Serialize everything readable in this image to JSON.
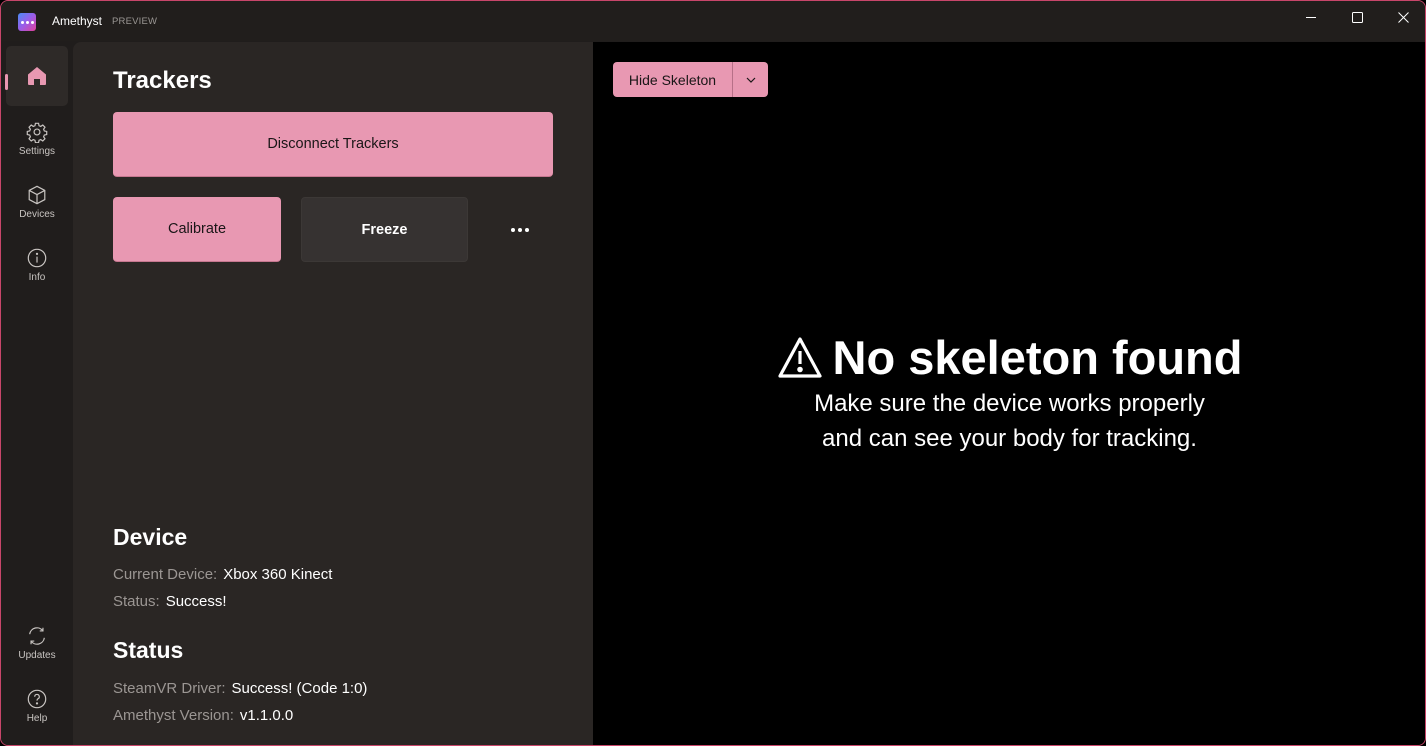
{
  "window": {
    "app_name": "Amethyst",
    "badge": "PREVIEW",
    "icons": {
      "app": "amethyst-logo-icon",
      "minimize": "minimize-icon",
      "maximize": "maximize-icon",
      "close": "close-icon"
    }
  },
  "nav": {
    "items": [
      {
        "id": "home",
        "label": "",
        "icon": "home-icon",
        "active": true
      },
      {
        "id": "settings",
        "label": "Settings",
        "icon": "gear-icon",
        "active": false
      },
      {
        "id": "devices",
        "label": "Devices",
        "icon": "cube-icon",
        "active": false
      },
      {
        "id": "info",
        "label": "Info",
        "icon": "info-icon",
        "active": false
      }
    ],
    "footer": [
      {
        "id": "updates",
        "label": "Updates",
        "icon": "refresh-icon"
      },
      {
        "id": "help",
        "label": "Help",
        "icon": "question-icon"
      }
    ]
  },
  "trackers": {
    "title": "Trackers",
    "disconnect_label": "Disconnect Trackers",
    "calibrate_label": "Calibrate",
    "freeze_label": "Freeze",
    "more_icon": "more-horizontal-icon"
  },
  "device": {
    "title": "Device",
    "current_device_label": "Current Device:",
    "current_device_value": "Xbox 360 Kinect",
    "status_label": "Status:",
    "status_value": "Success!"
  },
  "status": {
    "title": "Status",
    "driver_label": "SteamVR Driver:",
    "driver_value": "Success! (Code 1:0)",
    "version_label": "Amethyst Version:",
    "version_value": "v1.1.0.0"
  },
  "preview": {
    "skeleton_button_label": "Hide Skeleton",
    "dropdown_icon": "chevron-down-icon",
    "empty_icon": "warning-icon",
    "empty_title": "No skeleton found",
    "empty_line1": "Make sure the device works properly",
    "empty_line2": "and can see your body for tracking."
  },
  "colors": {
    "accent": "#e898b2",
    "window_border": "#c8466a",
    "panel_bg": "#2a2624",
    "nav_bg": "#201d1c"
  }
}
